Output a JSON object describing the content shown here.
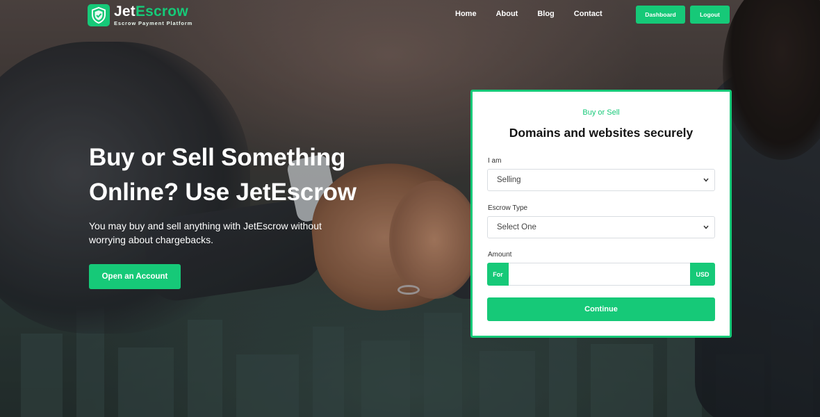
{
  "brand": {
    "name_part1": "Jet",
    "name_part2": "Escrow",
    "tagline": "Escrow Payment Platform",
    "accent_color": "#16c978",
    "logo_icon": "shield-icon"
  },
  "nav": {
    "items": [
      {
        "label": "Home"
      },
      {
        "label": "About"
      },
      {
        "label": "Blog"
      },
      {
        "label": "Contact"
      }
    ],
    "dashboard_label": "Dashboard",
    "logout_label": "Logout"
  },
  "hero": {
    "title": "Buy or Sell Something Online? Use JetEscrow",
    "subtitle": "You may buy and sell anything with JetEscrow without worrying about chargebacks.",
    "cta_label": "Open an Account"
  },
  "form": {
    "eyebrow": "Buy or Sell",
    "title": "Domains and websites securely",
    "role_label": "I am",
    "role_value": "Selling",
    "escrow_type_label": "Escrow Type",
    "escrow_type_value": "Select One",
    "amount_label": "Amount",
    "amount_prefix": "For",
    "amount_value": "",
    "amount_suffix": "USD",
    "submit_label": "Continue"
  }
}
